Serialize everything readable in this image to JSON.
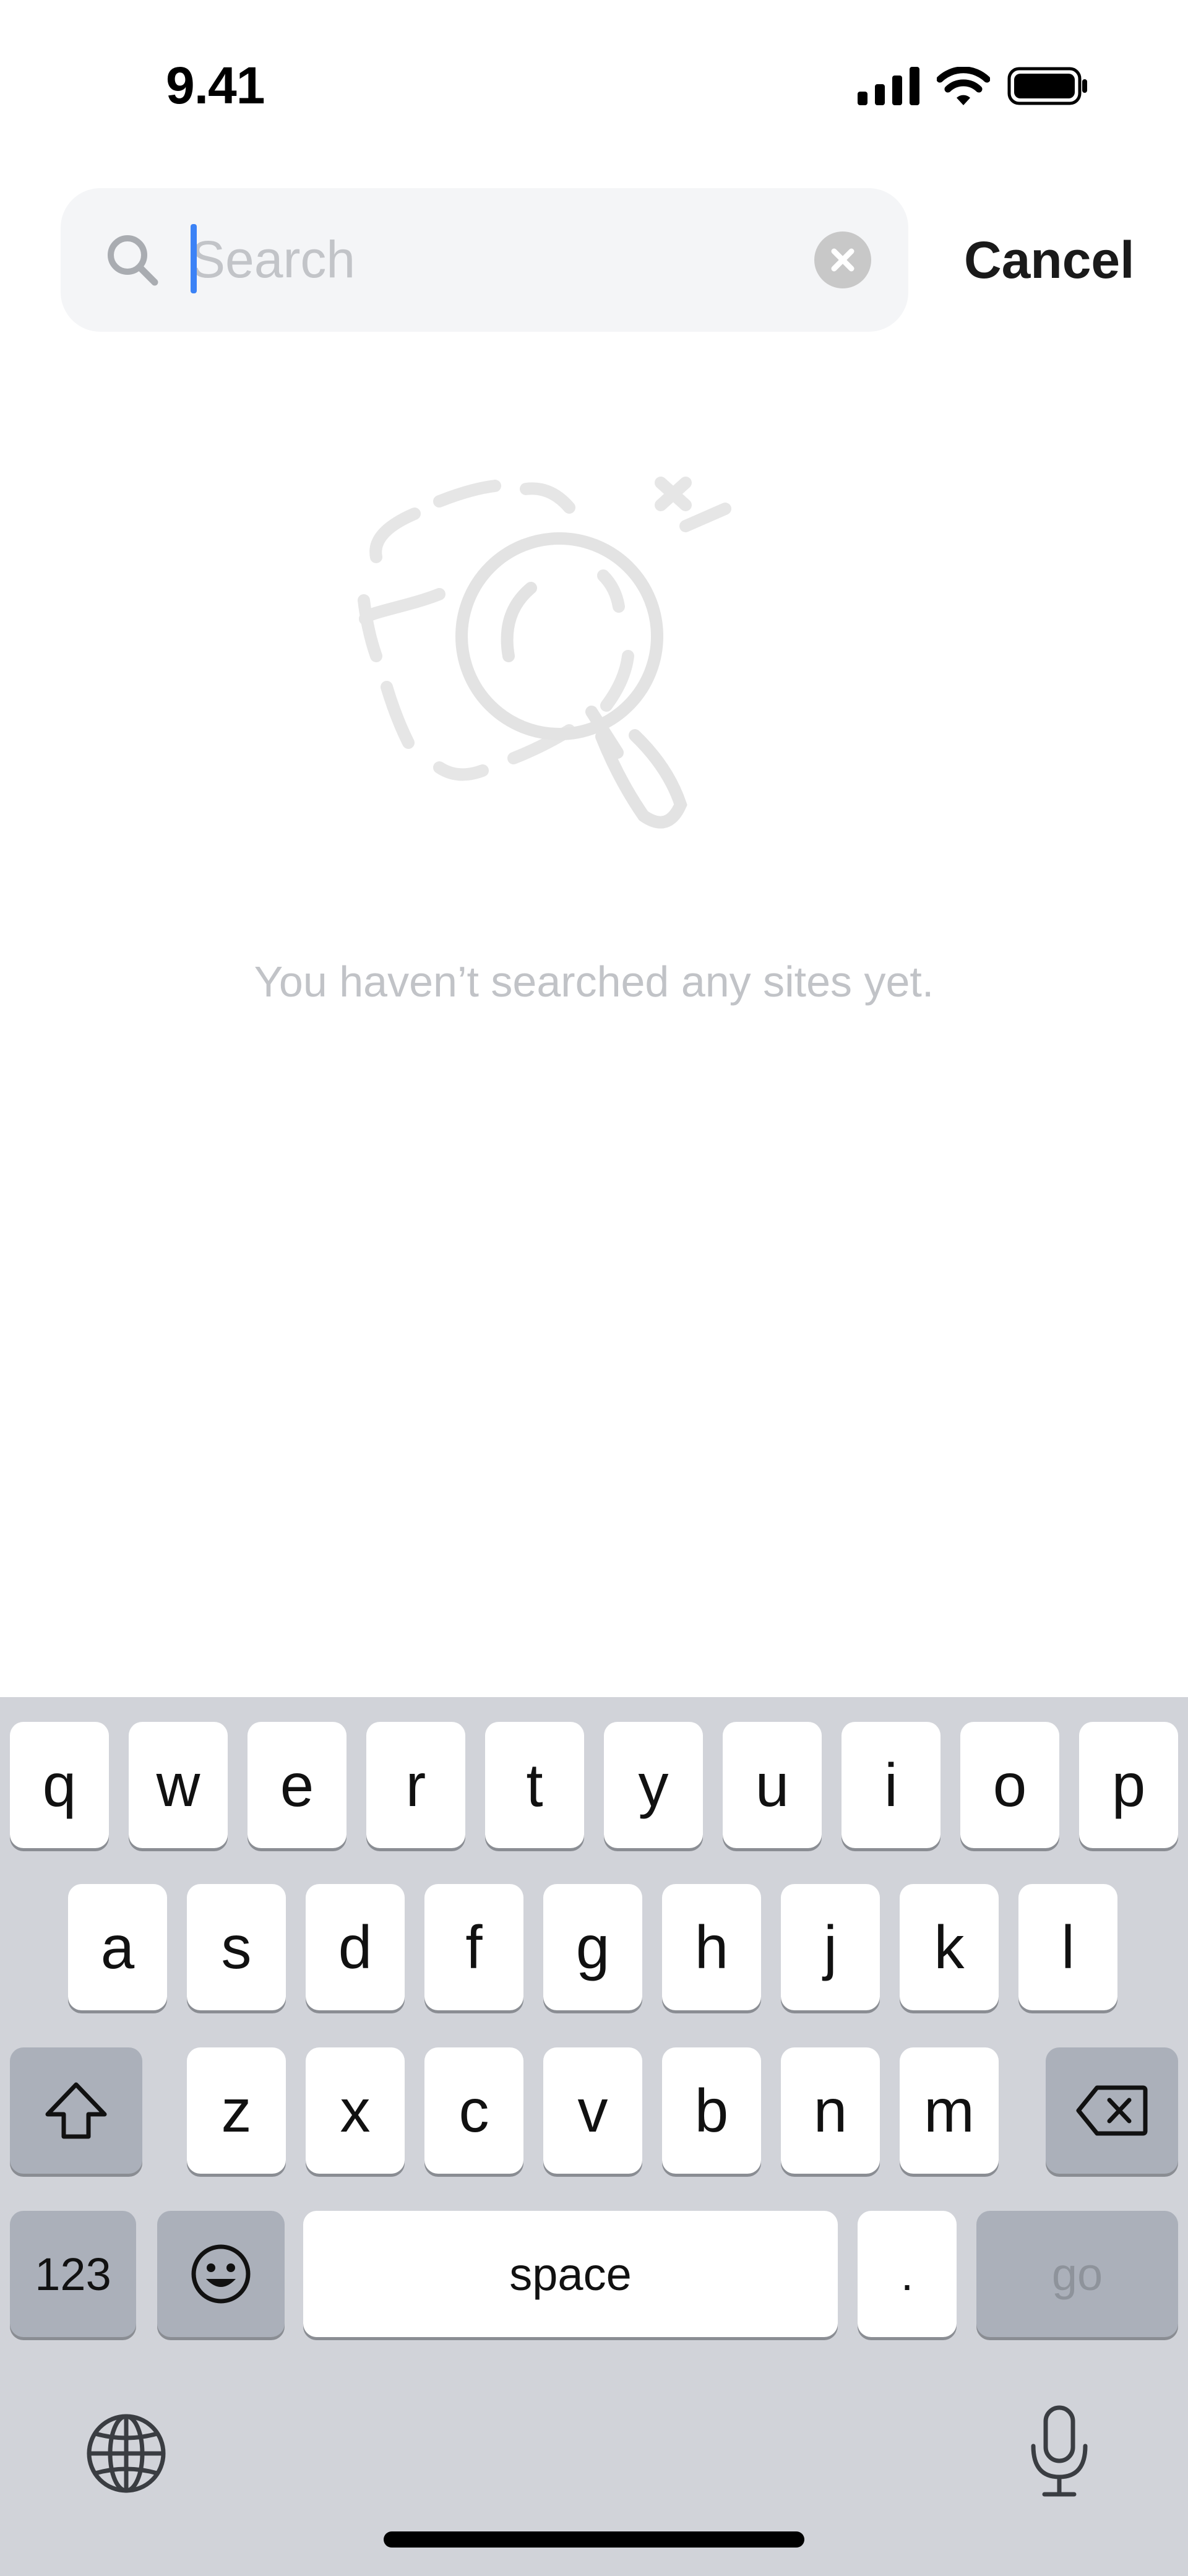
{
  "status_bar": {
    "time": "9.41"
  },
  "search": {
    "placeholder": "Search",
    "value": "",
    "cancel_label": "Cancel"
  },
  "empty_state": {
    "message": "You haven’t searched any sites yet."
  },
  "keyboard": {
    "row1": [
      "q",
      "w",
      "e",
      "r",
      "t",
      "y",
      "u",
      "i",
      "o",
      "p"
    ],
    "row2": [
      "a",
      "s",
      "d",
      "f",
      "g",
      "h",
      "j",
      "k",
      "l"
    ],
    "row3": [
      "z",
      "x",
      "c",
      "v",
      "b",
      "n",
      "m"
    ],
    "numbers_label": "123",
    "space_label": "space",
    "period_label": ".",
    "go_label": "go"
  },
  "colors": {
    "caret": "#3b82f6",
    "keyboard_bg": "#d1d3d9",
    "placeholder": "#c2c4c8",
    "empty_text": "#c1c3c7"
  },
  "icons": [
    "search-icon",
    "clear-icon",
    "magnifier-illustration",
    "shift-icon",
    "backspace-icon",
    "emoji-icon",
    "globe-icon",
    "microphone-icon",
    "signal-icon",
    "wifi-icon",
    "battery-icon"
  ]
}
